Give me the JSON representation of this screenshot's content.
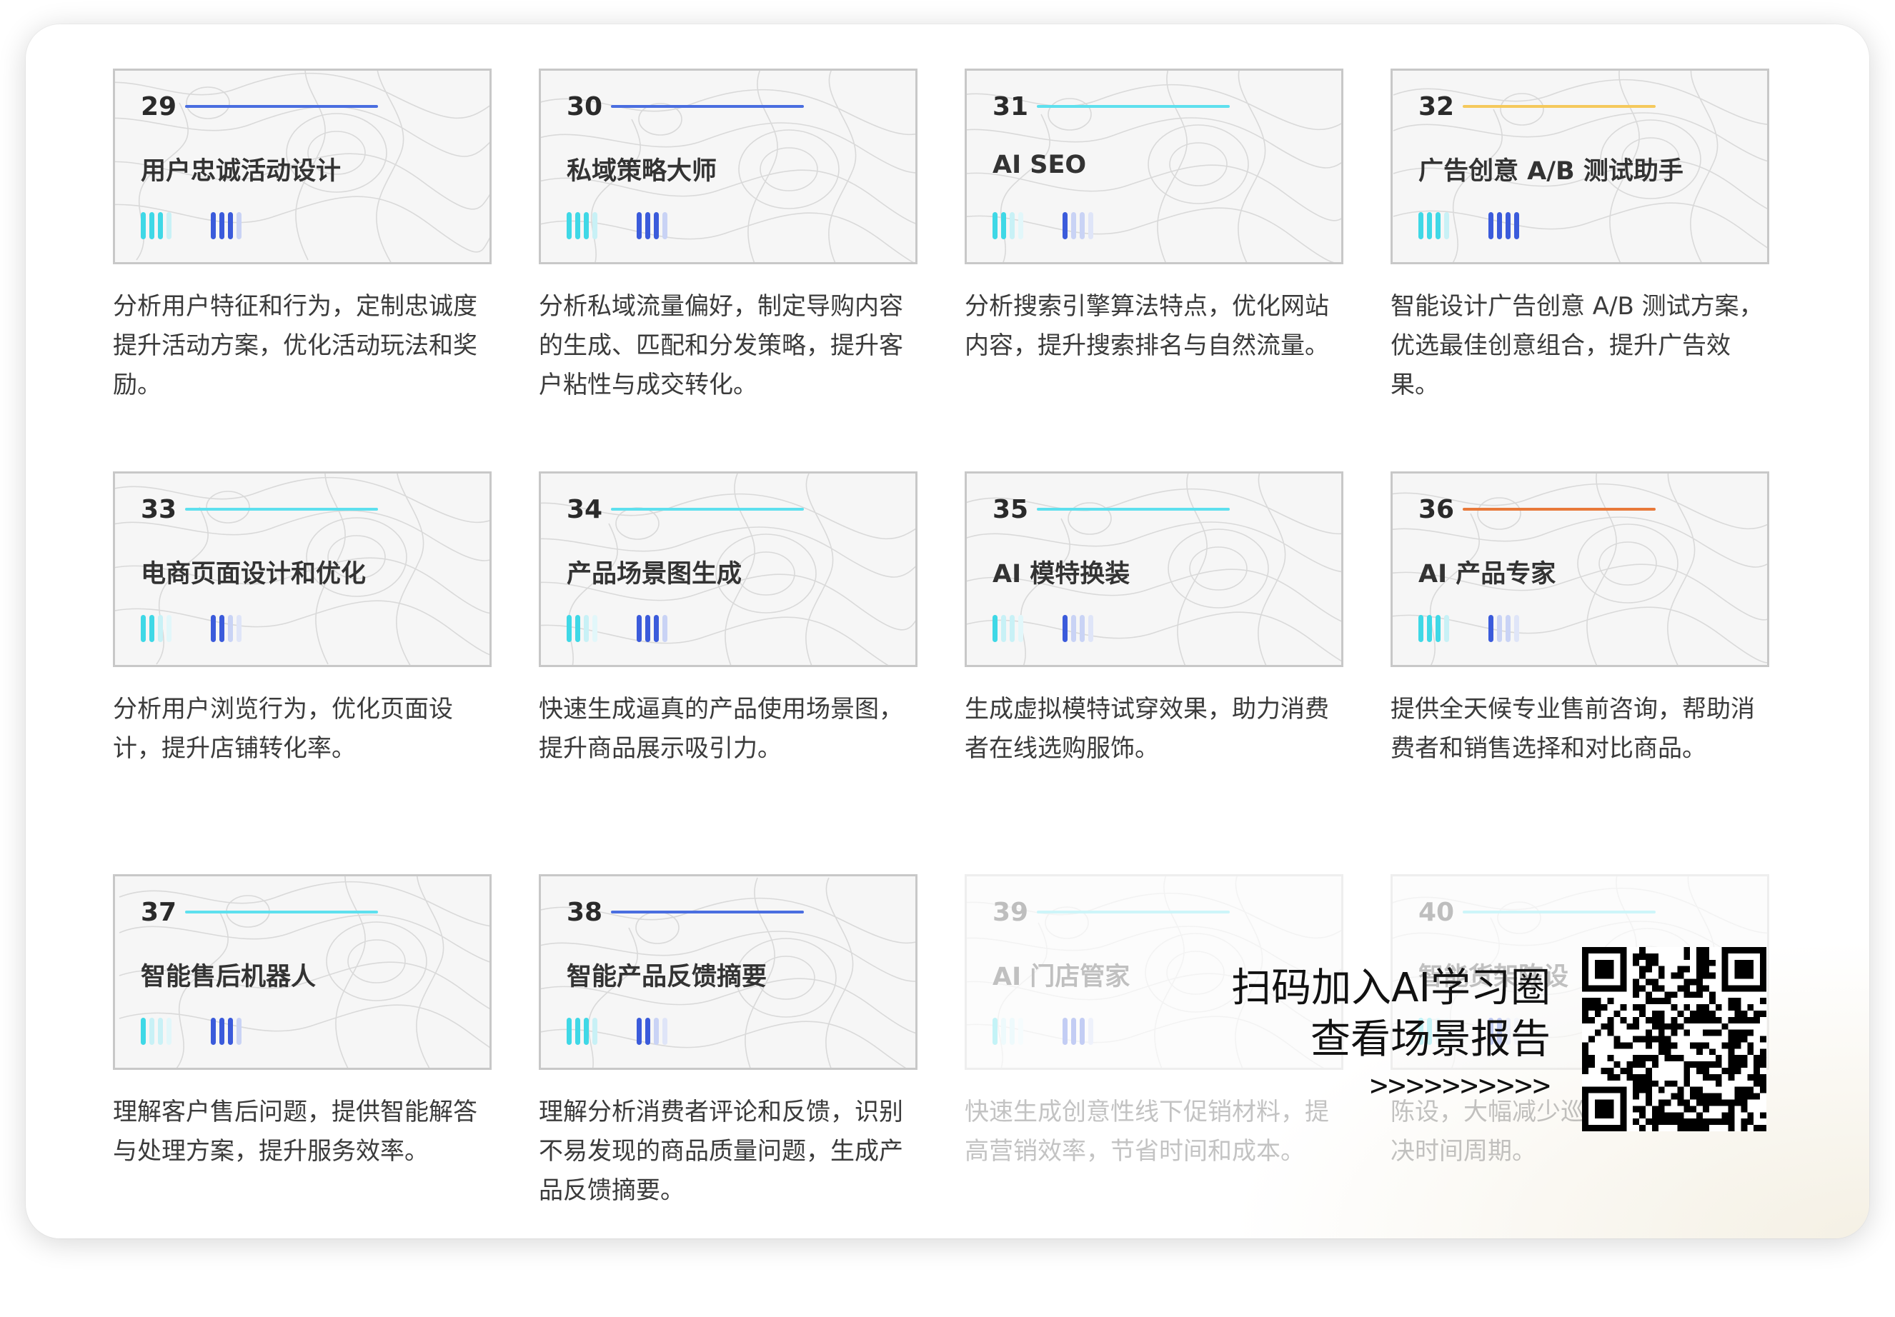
{
  "cards": [
    {
      "num": "29",
      "title": "用户忠诚活动设计",
      "desc": "分析用户特征和行为，定制忠诚度提升活动方案，优化活动玩法和奖励。",
      "accent": "#4a6ee0",
      "bars1": [
        "#3fd8e6",
        "#3fd8e6",
        "#3fd8e6",
        "#c8f1f6"
      ],
      "bars2": [
        "#3b5bdb",
        "#3b5bdb",
        "#3b5bdb",
        "#c9d3f5"
      ],
      "faded": false
    },
    {
      "num": "30",
      "title": "私域策略大师",
      "desc": "分析私域流量偏好，制定导购内容的生成、匹配和分发策略，提升客户粘性与成交转化。",
      "accent": "#4a6ee0",
      "bars1": [
        "#3fd8e6",
        "#3fd8e6",
        "#3fd8e6",
        "#c8f1f6"
      ],
      "bars2": [
        "#3b5bdb",
        "#3b5bdb",
        "#3b5bdb",
        "#c9d3f5"
      ],
      "faded": false
    },
    {
      "num": "31",
      "title": "AI SEO",
      "desc": "分析搜索引擎算法特点，优化网站内容，提升搜索排名与自然流量。",
      "accent": "#5ee0ee",
      "bars1": [
        "#3fd8e6",
        "#3fd8e6",
        "#c8f1f6",
        "#e2f7fa"
      ],
      "bars2": [
        "#3b5bdb",
        "#c9d3f5",
        "#c9d3f5",
        "#dfe5f8"
      ],
      "faded": false
    },
    {
      "num": "32",
      "title": "广告创意 A/B 测试助手",
      "desc": "智能设计广告创意 A/B 测试方案，优选最佳创意组合，提升广告效果。",
      "accent": "#f5c95c",
      "bars1": [
        "#3fd8e6",
        "#3fd8e6",
        "#3fd8e6",
        "#c8f1f6"
      ],
      "bars2": [
        "#3b5bdb",
        "#3b5bdb",
        "#3b5bdb",
        "#3b5bdb"
      ],
      "faded": false
    },
    {
      "num": "33",
      "title": "电商页面设计和优化",
      "desc": "分析用户浏览行为，优化页面设计，提升店铺转化率。",
      "accent": "#5ee0ee",
      "bars1": [
        "#3fd8e6",
        "#3fd8e6",
        "#c8f1f6",
        "#e2f7fa"
      ],
      "bars2": [
        "#3b5bdb",
        "#3b5bdb",
        "#c9d3f5",
        "#dfe5f8"
      ],
      "faded": false
    },
    {
      "num": "34",
      "title": "产品场景图生成",
      "desc": "快速生成逼真的产品使用场景图，提升商品展示吸引力。",
      "accent": "#5ee0ee",
      "bars1": [
        "#3fd8e6",
        "#3fd8e6",
        "#c8f1f6",
        "#e2f7fa"
      ],
      "bars2": [
        "#3b5bdb",
        "#3b5bdb",
        "#3b5bdb",
        "#c9d3f5"
      ],
      "faded": false
    },
    {
      "num": "35",
      "title": "AI 模特换装",
      "desc": "生成虚拟模特试穿效果，助力消费者在线选购服饰。",
      "accent": "#5ee0ee",
      "bars1": [
        "#3fd8e6",
        "#c8f1f6",
        "#c8f1f6",
        "#e2f7fa"
      ],
      "bars2": [
        "#3b5bdb",
        "#c9d3f5",
        "#c9d3f5",
        "#dfe5f8"
      ],
      "faded": false
    },
    {
      "num": "36",
      "title": "AI 产品专家",
      "desc": "提供全天候专业售前咨询，帮助消费者和销售选择和对比商品。",
      "accent": "#e8793a",
      "bars1": [
        "#3fd8e6",
        "#3fd8e6",
        "#3fd8e6",
        "#c8f1f6"
      ],
      "bars2": [
        "#3b5bdb",
        "#c9d3f5",
        "#c9d3f5",
        "#dfe5f8"
      ],
      "faded": false
    },
    {
      "num": "37",
      "title": "智能售后机器人",
      "desc": "理解客户售后问题，提供智能解答与处理方案，提升服务效率。",
      "accent": "#5ee0ee",
      "bars1": [
        "#3fd8e6",
        "#c8f1f6",
        "#c8f1f6",
        "#e2f7fa"
      ],
      "bars2": [
        "#3b5bdb",
        "#3b5bdb",
        "#3b5bdb",
        "#c9d3f5"
      ],
      "faded": false
    },
    {
      "num": "38",
      "title": "智能产品反馈摘要",
      "desc": "理解分析消费者评论和反馈，识别不易发现的商品质量问题，生成产品反馈摘要。",
      "accent": "#4a6ee0",
      "bars1": [
        "#3fd8e6",
        "#3fd8e6",
        "#3fd8e6",
        "#c8f1f6"
      ],
      "bars2": [
        "#3b5bdb",
        "#3b5bdb",
        "#c9d3f5",
        "#dfe5f8"
      ],
      "faded": false
    },
    {
      "num": "39",
      "title": "AI 门店管家",
      "desc": "快速生成创意性线下促销材料，提高营销效率，节省时间和成本。",
      "accent": "#5ee0ee",
      "bars1": [
        "#3fd8e6",
        "#c8f1f6",
        "#c8f1f6",
        "#e2f7fa"
      ],
      "bars2": [
        "#3b5bdb",
        "#3b5bdb",
        "#3b5bdb",
        "#c9d3f5"
      ],
      "faded": true
    },
    {
      "num": "40",
      "title": "智能货架陈设",
      "desc": "陈设，大幅减少巡店成本和问题解决时间周期。",
      "accent": "#5ee0ee",
      "bars1": [
        "#3fd8e6",
        "#3fd8e6",
        "#c8f1f6",
        "#e2f7fa"
      ],
      "bars2": [
        "#3b5bdb",
        "#3b5bdb",
        "#c9d3f5",
        "#dfe5f8"
      ],
      "faded": true
    }
  ],
  "promo": {
    "line1": "扫码加入AI学习圈",
    "line2": "查看场景报告",
    "arrows": ">>>>>>>>>>",
    "qr_icon": "qr-code-icon"
  }
}
